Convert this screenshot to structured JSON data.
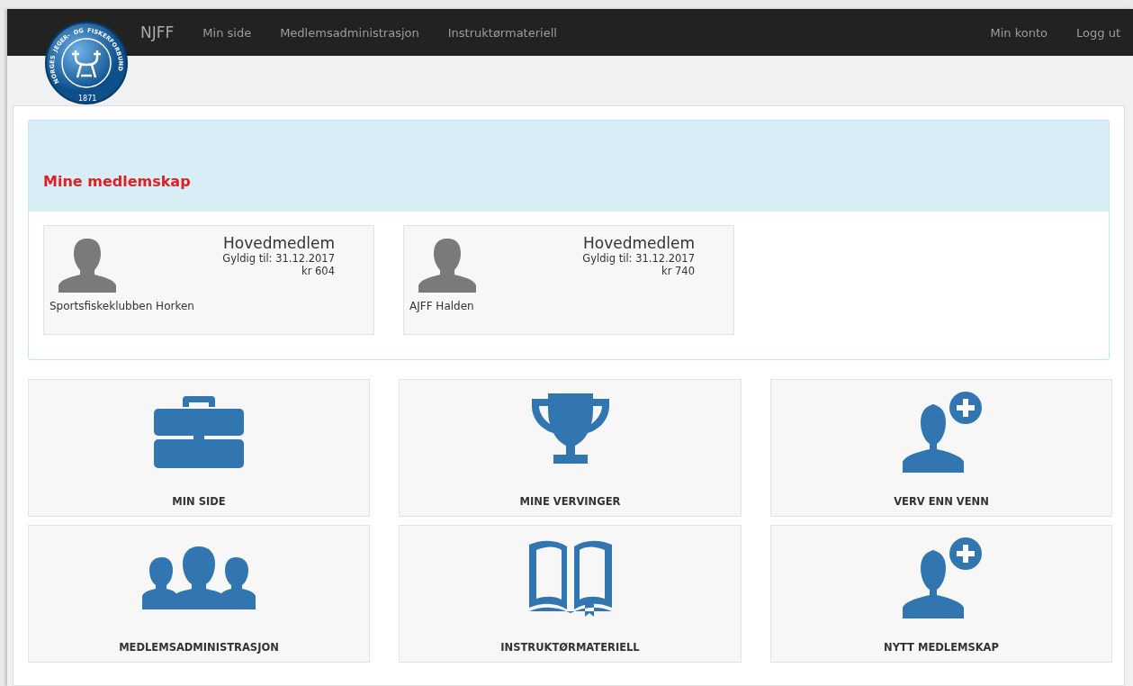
{
  "logo": {
    "ring_words": [
      "NORGES",
      "JEGER-",
      "OG",
      "FISKERFORBUND"
    ],
    "year": "1871"
  },
  "navbar": {
    "brand": "NJFF",
    "links": [
      "Min side",
      "Medlemsadministrasjon",
      "Instruktørmateriell"
    ],
    "right_links": [
      "Min konto",
      "Logg ut"
    ]
  },
  "memberships": {
    "title": "Mine medlemskap",
    "cards": [
      {
        "type": "Hovedmedlem",
        "valid": "Gyldig til: 31.12.2017",
        "price": "kr 604",
        "club": "Sportsfiskeklubben Horken"
      },
      {
        "type": "Hovedmedlem",
        "valid": "Gyldig til: 31.12.2017",
        "price": "kr 740",
        "club": "AJFF Halden"
      }
    ]
  },
  "tiles": [
    {
      "kind": "briefcase",
      "label": "MIN SIDE"
    },
    {
      "kind": "trophy",
      "label": "MINE VERVINGER"
    },
    {
      "kind": "add-person",
      "label": "VERV ENN VENN"
    },
    {
      "kind": "group",
      "label": "MEDLEMSADMINISTRASJON"
    },
    {
      "kind": "book",
      "label": "INSTRUKTØRMATERIELL"
    },
    {
      "kind": "add-person",
      "label": "NYTT MEDLEMSKAP"
    }
  ]
}
